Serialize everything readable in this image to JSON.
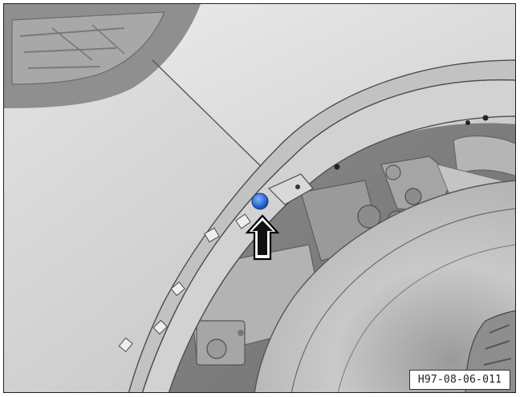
{
  "figure": {
    "reference_code": "H97-08-06-011",
    "marker_color": "#2f6fd6",
    "arrow_direction": "up"
  }
}
